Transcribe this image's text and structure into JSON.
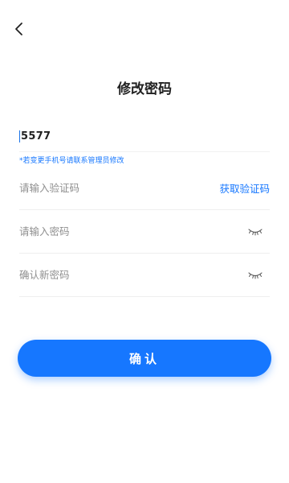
{
  "header": {
    "title": "修改密码"
  },
  "form": {
    "phone_value": "5577",
    "phone_hint": "*若变更手机号请联系管理员修改",
    "code_placeholder": "请输入验证码",
    "get_code_label": "获取验证码",
    "password_placeholder": "请输入密码",
    "confirm_password_placeholder": "确认新密码"
  },
  "actions": {
    "confirm_label": "确认"
  },
  "icons": {
    "back": "chevron-left-icon",
    "password_visibility": "eye-closed-icon"
  },
  "colors": {
    "accent": "#1677ff",
    "text": "#222222",
    "placeholder": "#8f8f8f",
    "divider": "#eeeeee"
  }
}
